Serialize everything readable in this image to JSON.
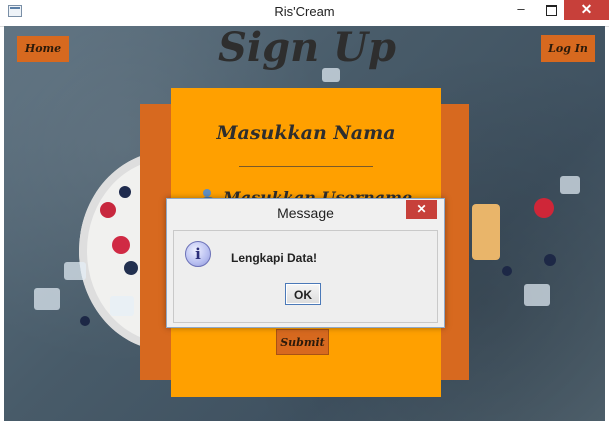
{
  "window": {
    "title": "Ris'Cream",
    "minimize_glyph": "–",
    "close_glyph": "✕"
  },
  "nav": {
    "home_label": "Home",
    "login_label": "Log In"
  },
  "page": {
    "heading": "Sign Up"
  },
  "form": {
    "title": "Masukkan Nama",
    "username_label": "Masukkan Username",
    "submit_label": "Submit"
  },
  "dialog": {
    "title": "Message",
    "close_glyph": "✕",
    "icon_glyph": "i",
    "message": "Lengkapi Data!",
    "ok_label": "OK"
  },
  "colors": {
    "button_orange": "#d7691f",
    "panel_orange": "#ffa000",
    "close_red": "#c7403a"
  }
}
